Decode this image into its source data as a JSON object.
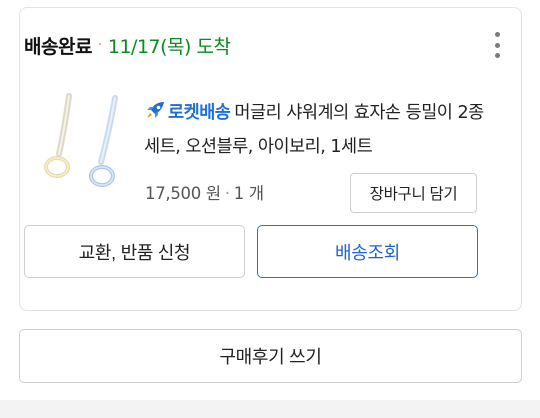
{
  "order": {
    "status": "배송완료",
    "separator": "·",
    "arrival": "11/17(목) 도착",
    "more_icon": "kebab-vertical-icon",
    "colors": {
      "arrival": "#0a8a1f",
      "rocket": "#1e6fd9",
      "track_button": "#1e63d0"
    }
  },
  "product": {
    "thumbnail_icon": "shower-thermometer-product-image",
    "badge_icon": "rocket-icon",
    "badge": "로켓배송",
    "name": "머글리 샤워계의 효자손 등밀이 2종 세트, 오션블루, 아이보리, 1세트",
    "price": "17,500 원",
    "separator": "·",
    "quantity": "1 개",
    "cart_button": "장바구니 담기"
  },
  "actions": {
    "exchange_return": "교환, 반품 신청",
    "track_delivery": "배송조회",
    "write_review": "구매후기 쓰기"
  }
}
